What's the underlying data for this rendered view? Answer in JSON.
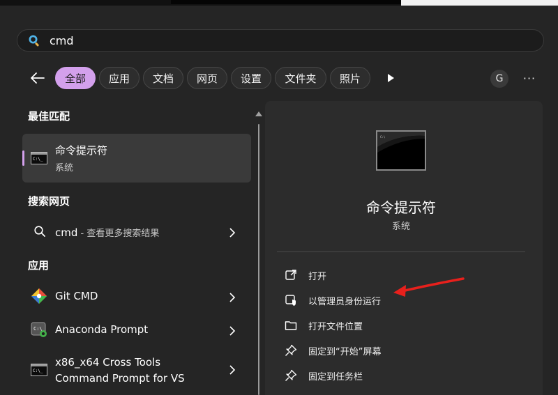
{
  "search": {
    "query": "cmd"
  },
  "filters": [
    {
      "label": "全部",
      "active": true
    },
    {
      "label": "应用",
      "active": false
    },
    {
      "label": "文档",
      "active": false
    },
    {
      "label": "网页",
      "active": false
    },
    {
      "label": "设置",
      "active": false
    },
    {
      "label": "文件夹",
      "active": false
    },
    {
      "label": "照片",
      "active": false
    }
  ],
  "account_initial": "G",
  "more_label": "···",
  "sections": {
    "best_match": "最佳匹配",
    "web_search": "搜索网页",
    "apps": "应用"
  },
  "best_match": {
    "title": "命令提示符",
    "subtitle": "系统"
  },
  "web_result": {
    "query": "cmd",
    "hint": " - 查看更多搜索结果"
  },
  "apps": [
    {
      "label": "Git CMD",
      "icon": "git-icon"
    },
    {
      "label": "Anaconda Prompt",
      "icon": "anaconda-prompt-icon"
    },
    {
      "label_line1": "x86_x64 Cross Tools",
      "label_line2": "Command Prompt for VS",
      "icon": "command-prompt-icon"
    }
  ],
  "detail": {
    "title": "命令提示符",
    "subtitle": "系统",
    "actions": [
      {
        "label": "打开",
        "icon": "open-external-icon"
      },
      {
        "label": "以管理员身份运行",
        "icon": "run-as-admin-icon"
      },
      {
        "label": "打开文件位置",
        "icon": "folder-icon"
      },
      {
        "label": "固定到“开始”屏幕",
        "icon": "pin-icon"
      },
      {
        "label": "固定到任务栏",
        "icon": "pin-icon"
      }
    ]
  },
  "colors": {
    "accent": "#d3a0ec",
    "panel_bg": "#252525",
    "arrow": "#e8201c"
  }
}
